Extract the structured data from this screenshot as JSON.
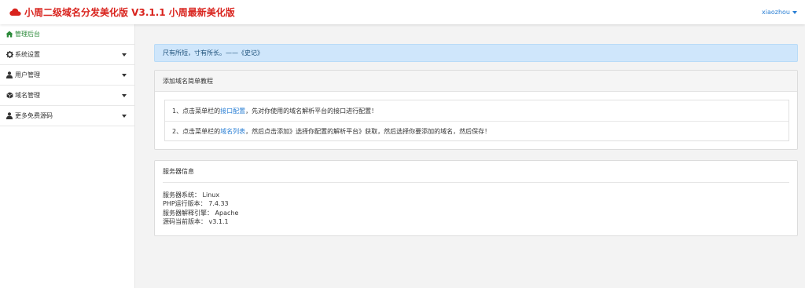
{
  "header": {
    "title": "小周二级域名分发美化版 V3.1.1 小周最新美化版",
    "user": "xiaozhou"
  },
  "colors": {
    "brand": "#d9231d",
    "link": "#2a7fd4",
    "active_nav": "#2c8a3a",
    "alert_bg": "#cfe6fb"
  },
  "sidebar": {
    "items": [
      {
        "label": "管理后台",
        "icon": "home-icon"
      },
      {
        "label": "系统设置",
        "icon": "gear-icon"
      },
      {
        "label": "用户管理",
        "icon": "user-icon"
      },
      {
        "label": "域名管理",
        "icon": "cube-icon"
      },
      {
        "label": "更多免费源码",
        "icon": "user-icon"
      }
    ]
  },
  "alert": {
    "text": "尺有所短，寸有所长。——《史记》"
  },
  "tutorial": {
    "title": "添加域名简单教程",
    "step1": {
      "prefix": "1、点击菜单栏的",
      "link": "接口配置",
      "suffix": "，先对你使用的域名解析平台的接口进行配置！"
    },
    "step2": {
      "prefix": "2、点击菜单栏的",
      "link": "域名列表",
      "suffix": "，然后点击添加》选择你配置的解析平台》获取，然后选择你要添加的域名，然后保存！"
    }
  },
  "server": {
    "title": "服务器信息",
    "os": "服务器系统：  Linux",
    "php": "PHP运行版本：  7.4.33",
    "engine": "服务器解释引擎：  Apache",
    "version": "源码当前版本：  v3.1.1"
  }
}
